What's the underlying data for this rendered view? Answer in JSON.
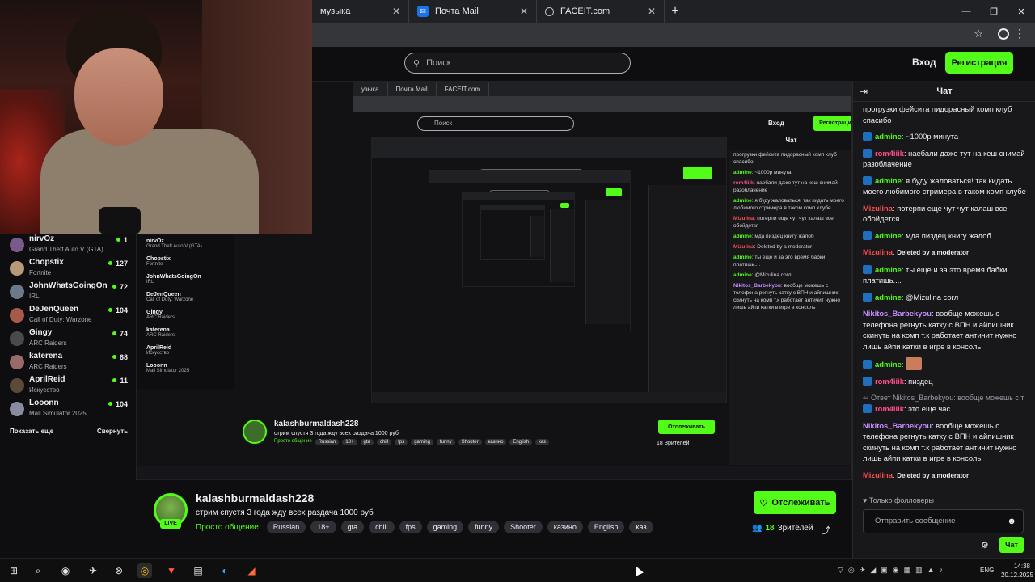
{
  "browser": {
    "tabs": [
      {
        "label": "музыка"
      },
      {
        "label": "Почта Mail"
      },
      {
        "label": "FACEIT.com"
      }
    ],
    "new_tab": "+"
  },
  "header": {
    "search_placeholder": "Поиск",
    "login_label": "Вход",
    "register_label": "Регистрация"
  },
  "sidebar": {
    "channels": [
      {
        "name": "nirvOz",
        "game": "Grand Theft Auto V (GTA)",
        "viewers": "1",
        "color": "#7a5a8a"
      },
      {
        "name": "Chopstix",
        "game": "Fortnite",
        "viewers": "127",
        "color": "#b89a7a"
      },
      {
        "name": "JohnWhatsGoingOn",
        "game": "IRL",
        "viewers": "72",
        "color": "#6a7a8a"
      },
      {
        "name": "DeJenQueen",
        "game": "Call of Duty: Warzone",
        "viewers": "104",
        "color": "#a85a4a"
      },
      {
        "name": "Gingy",
        "game": "ARC Raiders",
        "viewers": "74",
        "color": "#4a4a4a"
      },
      {
        "name": "katerena",
        "game": "ARC Raiders",
        "viewers": "68",
        "color": "#9a6a6a"
      },
      {
        "name": "AprilReid",
        "game": "Искусство",
        "viewers": "11",
        "color": "#5a4a3a"
      },
      {
        "name": "Looonn",
        "game": "Mall Simulator 2025",
        "viewers": "104",
        "color": "#8a8aa0"
      }
    ],
    "show_more": "Показать еще",
    "collapse": "Свернуть"
  },
  "stream": {
    "channel_name": "kalashburmaldash228",
    "title": "стрим спустя 3 года жду всех раздача 1000 руб",
    "category": "Просто общение",
    "tags": [
      "Russian",
      "18+",
      "gta",
      "chill",
      "fps",
      "gaming",
      "funny",
      "Shooter",
      "казино",
      "English",
      "каз"
    ],
    "live_badge": "LIVE",
    "follow_label": "Отслеживать",
    "viewer_count": "18",
    "viewer_label": "Зрителей"
  },
  "chat": {
    "title": "Чат",
    "messages": [
      {
        "user": "",
        "color": "#efeff1",
        "text": "прогрузки фейсита пидорасный комп клуб спасибо"
      },
      {
        "user": "admine",
        "color": "#53fc18",
        "badge": true,
        "text": ": ~1000р минута"
      },
      {
        "user": "rom4iiik",
        "color": "#ff4d8a",
        "badge": true,
        "text": ": наебали даже тут на кеш снимай разоблачение"
      },
      {
        "user": "admine",
        "color": "#53fc18",
        "badge": true,
        "text": ": я буду жаловаться! так кидать моего любимого стримера в таком комп клубе"
      },
      {
        "user": "Mizulina",
        "color": "#ff4d4d",
        "text": ": потерпи еще чут чут калаш все обойдется"
      },
      {
        "user": "admine",
        "color": "#53fc18",
        "badge": true,
        "text": ": мда пиздец книгу жалоб"
      },
      {
        "user": "Mizulina",
        "color": "#ff4d4d",
        "deleted": "Deleted by a moderator"
      },
      {
        "user": "admine",
        "color": "#53fc18",
        "badge": true,
        "text": ": ты еще и за это время бабки платишь...."
      },
      {
        "user": "admine",
        "color": "#53fc18",
        "badge": true,
        "text": ": @Mizulina согл"
      },
      {
        "user": "Nikitos_Barbekyou",
        "color": "#c58cff",
        "text": ": вообще можешь с телефона регнуть катку с ВПН и айпишник скинуть на комп т.к работает античит нужно лишь айпи катки в игре в консоль"
      },
      {
        "user": "admine",
        "color": "#53fc18",
        "badge": true,
        "text": ":",
        "emote": true
      },
      {
        "user": "rom4iiik",
        "color": "#ff4d8a",
        "badge": true,
        "text": ": пиздец"
      },
      {
        "reply": "Ответ Nikitos_Barbekyou: вообще можешь с т",
        "user": "rom4iiik",
        "color": "#ff4d8a",
        "badge": true,
        "text": ": это еще час"
      },
      {
        "user": "Nikitos_Barbekyou",
        "color": "#c58cff",
        "text": ": вообще можешь с телефона регнуть катку с ВПН и айпишник скинуть на комп т.к работает античит нужно лишь айпи катки в игре в консоль"
      },
      {
        "user": "Mizulina",
        "color": "#ff4d4d",
        "deleted": "Deleted by a moderator"
      }
    ],
    "followers_only": "Только фолловеры",
    "input_placeholder": "Отправить сообщение",
    "send_label": "Чат"
  },
  "taskbar": {
    "lang": "ENG",
    "time": "14:38",
    "date": "20.12.2025"
  },
  "nested": {
    "l1_tabs": [
      "узыка",
      "Почта Mail",
      "FACEIT.com"
    ],
    "l1_search": "Поиск",
    "l1_login": "Вход",
    "l1_register": "Регистрация",
    "l1_chat_title": "Чат",
    "l1_channel": "kalashburmaldash228",
    "l1_title": "стрим спустя 3 года жду всех раздача 1000 руб",
    "l1_follow": "Отслеживать",
    "l1_viewers": "18 Зрителей"
  },
  "colors": {
    "accent": "#53fc18",
    "background": "#0e0e10",
    "panel": "#18181b"
  }
}
